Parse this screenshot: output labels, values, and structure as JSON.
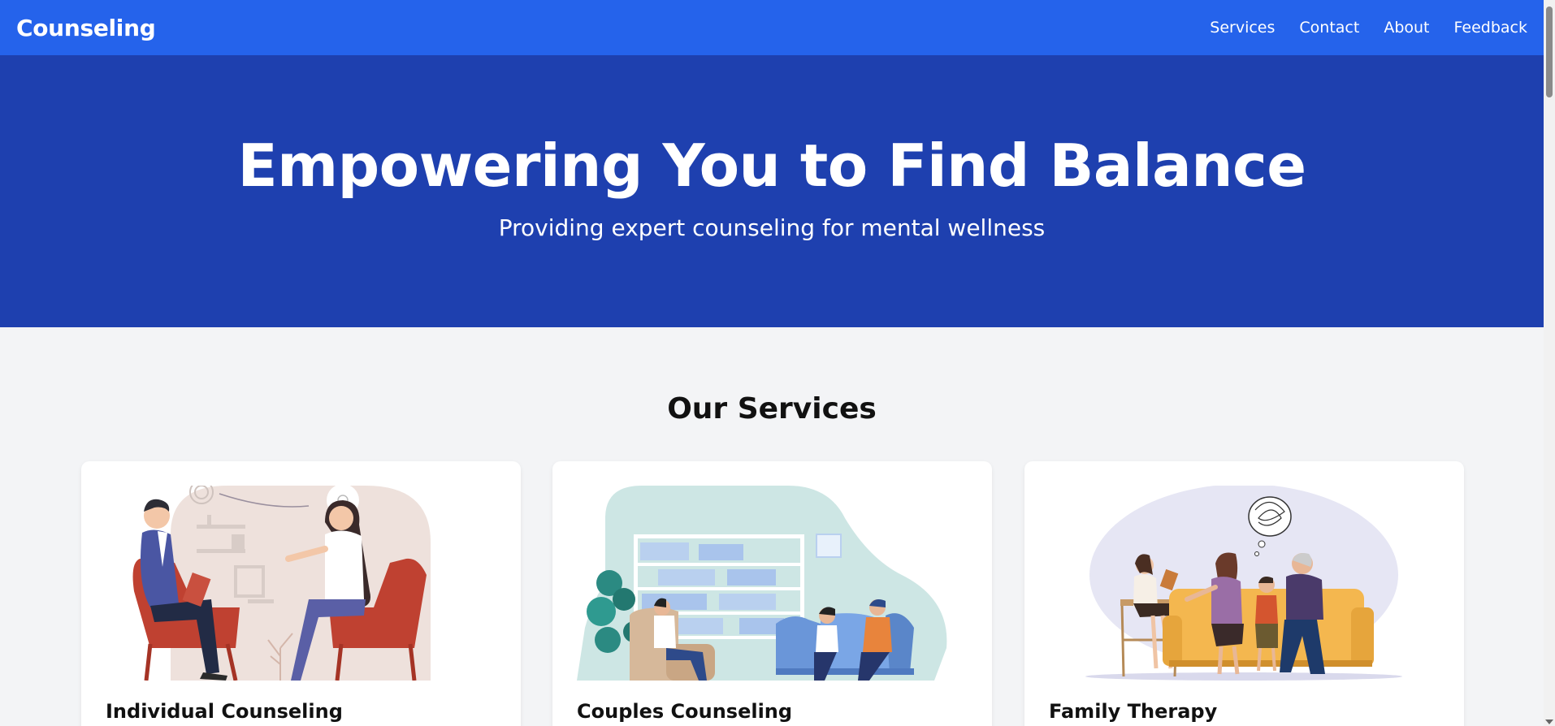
{
  "nav": {
    "brand": "Counseling",
    "links": [
      "Services",
      "Contact",
      "About",
      "Feedback"
    ]
  },
  "hero": {
    "title": "Empowering You to Find Balance",
    "subtitle": "Providing expert counseling for mental wellness"
  },
  "services": {
    "heading": "Our Services",
    "cards": [
      {
        "title": "Individual Counseling",
        "illustration": "individual-counseling-illustration"
      },
      {
        "title": "Couples Counseling",
        "illustration": "couples-counseling-illustration"
      },
      {
        "title": "Family Therapy",
        "illustration": "family-therapy-illustration"
      }
    ]
  },
  "colors": {
    "navbar": "#2563eb",
    "hero": "#1e40af",
    "page_background": "#f3f4f6"
  }
}
